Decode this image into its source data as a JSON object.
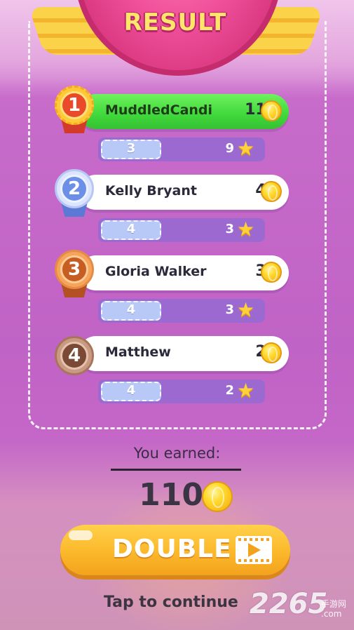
{
  "title": "RESULT",
  "leaderboard": [
    {
      "rank": "1",
      "name": "MuddledCandi",
      "score": "110",
      "moves": "3",
      "stars": "9",
      "medal": "gold"
    },
    {
      "rank": "2",
      "name": "Kelly Bryant",
      "score": "40",
      "moves": "4",
      "stars": "3",
      "medal": "silver"
    },
    {
      "rank": "3",
      "name": "Gloria Walker",
      "score": "35",
      "moves": "4",
      "stars": "3",
      "medal": "bronze"
    },
    {
      "rank": "4",
      "name": "Matthew",
      "score": "20",
      "moves": "4",
      "stars": "2",
      "medal": "brown"
    }
  ],
  "earned": {
    "label": "You earned:",
    "value": "110"
  },
  "double_button": {
    "label": "DOUBLE",
    "icon": "video-play-icon"
  },
  "tap_to_continue": "Tap to continue",
  "watermark": {
    "brand": "2265",
    "sub": "手游网",
    "domain": ".com"
  },
  "icons": {
    "coin": "coin-icon",
    "star": "star-icon"
  },
  "colors": {
    "accent_pink": "#f0509a",
    "highlight_green": "#3fd83b",
    "button_yellow": "#fbb82b",
    "background_purple": "#c063c6"
  }
}
